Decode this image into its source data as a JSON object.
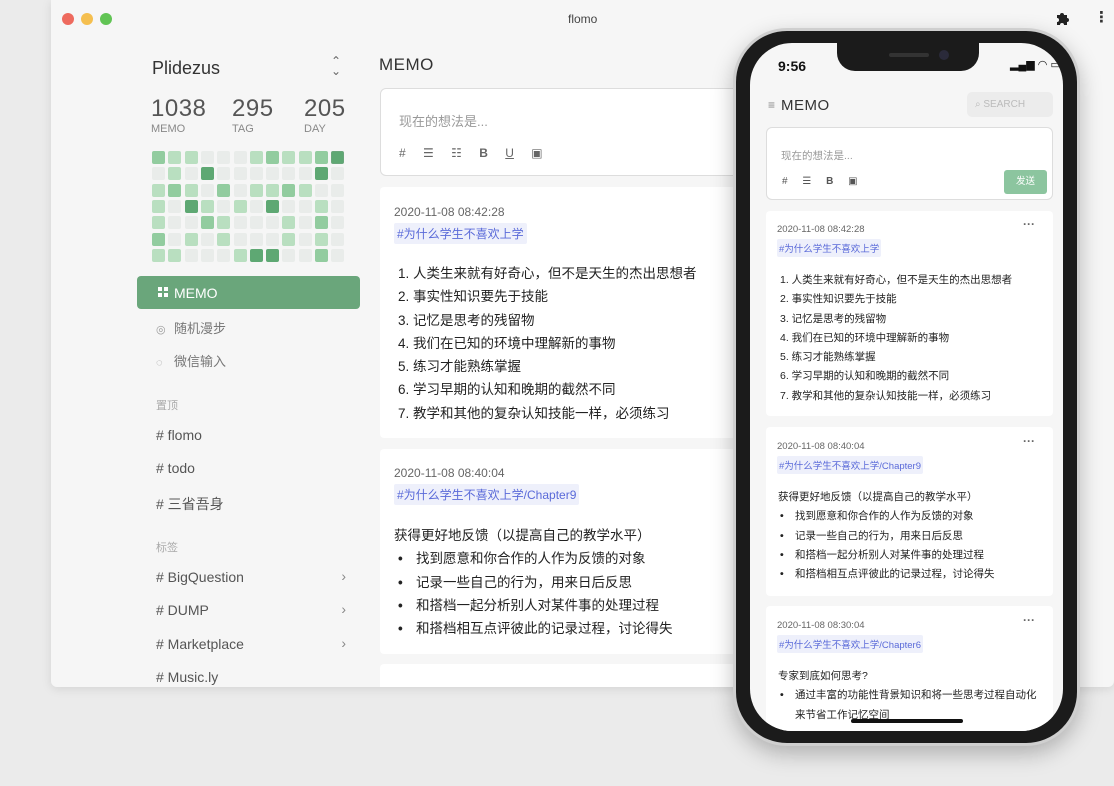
{
  "window": {
    "title": "flomo"
  },
  "sidebar": {
    "user": "Plidezus",
    "stats": [
      {
        "num": "1038",
        "label": "MEMO"
      },
      {
        "num": "295",
        "label": "TAG"
      },
      {
        "num": "205",
        "label": "DAY"
      }
    ],
    "nav": [
      {
        "label": "MEMO"
      },
      {
        "label": "随机漫步"
      },
      {
        "label": "微信输入"
      }
    ],
    "pinned_label": "置顶",
    "pinned": [
      "# flomo",
      "# todo",
      "# 三省吾身"
    ],
    "tags_label": "标签",
    "tags": [
      "# BigQuestion",
      "# DUMP",
      "# Marketplace",
      "# Music.ly"
    ]
  },
  "main": {
    "title": "MEMO",
    "editor": {
      "placeholder": "现在的想法是..."
    },
    "memos": [
      {
        "date": "2020-11-08 08:42:28",
        "tag": "#为什么学生不喜欢上学",
        "lines": [
          "1. 人类生来就有好奇心，但不是天生的杰出思想者",
          "2. 事实性知识要先于技能",
          "3. 记忆是思考的残留物",
          "4. 我们在已知的环境中理解新的事物",
          "5. 练习才能熟练掌握",
          "6. 学习早期的认知和晚期的截然不同",
          "7. 教学和其他的复杂认知技能一样，必须练习"
        ]
      },
      {
        "date": "2020-11-08 08:40:04",
        "tag": "#为什么学生不喜欢上学/Chapter9",
        "intro": "获得更好地反馈（以提高自己的教学水平）",
        "bullets": [
          "找到愿意和你合作的人作为反馈的对象",
          "记录一些自己的行为，用来日后反思",
          "和搭档一起分析别人对某件事的处理过程",
          "和搭档相互点评彼此的记录过程，讨论得失"
        ]
      }
    ]
  },
  "phone": {
    "time": "9:56",
    "title": "MEMO",
    "search_placeholder": "SEARCH",
    "editor_placeholder": "现在的想法是...",
    "send_label": "发送",
    "memos": [
      {
        "date": "2020-11-08 08:42:28",
        "tag": "#为什么学生不喜欢上学",
        "lines": [
          "1. 人类生来就有好奇心，但不是天生的杰出思想者",
          "2. 事实性知识要先于技能",
          "3. 记忆是思考的残留物",
          "4. 我们在已知的环境中理解新的事物",
          "5. 练习才能熟练掌握",
          "6. 学习早期的认知和晚期的截然不同",
          "7. 教学和其他的复杂认知技能一样，必须练习"
        ]
      },
      {
        "date": "2020-11-08 08:40:04",
        "tag": "#为什么学生不喜欢上学/Chapter9",
        "intro": "获得更好地反馈（以提高自己的教学水平）",
        "bullets": [
          "找到愿意和你合作的人作为反馈的对象",
          "记录一些自己的行为，用来日后反思",
          "和搭档一起分析别人对某件事的处理过程",
          "和搭档相互点评彼此的记录过程，讨论得失"
        ]
      },
      {
        "date": "2020-11-08 08:30:04",
        "tag": "#为什么学生不喜欢上学/Chapter6",
        "intro": "专家到底如何思考?",
        "bullets": [
          "通过丰富的功能性背景知识和将一些思考过程自动化",
          "来节省工作记忆空间"
        ]
      }
    ]
  },
  "colors": {
    "accent": "#6aa67b",
    "tag_text": "#5a6ad9",
    "tag_bg": "#eef0fb"
  },
  "heatmap": {
    "levels": [
      [
        2,
        1,
        1,
        0,
        0,
        0,
        1,
        2,
        1,
        1,
        2,
        3
      ],
      [
        0,
        1,
        0,
        3,
        0,
        0,
        0,
        0,
        0,
        0,
        3,
        0
      ],
      [
        1,
        2,
        1,
        0,
        2,
        0,
        1,
        1,
        2,
        1,
        0,
        0
      ],
      [
        1,
        0,
        3,
        1,
        0,
        1,
        0,
        3,
        0,
        0,
        1,
        0
      ],
      [
        1,
        0,
        0,
        2,
        1,
        0,
        0,
        0,
        1,
        0,
        2,
        0
      ],
      [
        2,
        0,
        1,
        0,
        1,
        0,
        0,
        0,
        1,
        0,
        1,
        0
      ],
      [
        1,
        1,
        0,
        0,
        0,
        1,
        3,
        3,
        0,
        0,
        2,
        0
      ]
    ]
  }
}
